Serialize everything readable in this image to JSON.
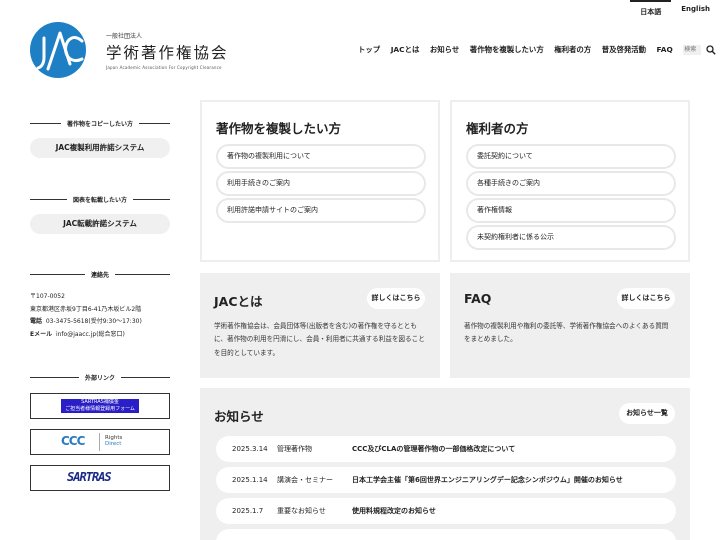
{
  "lang": {
    "ja": "日本語",
    "en": "English"
  },
  "logo": {
    "small": "一般社団法人",
    "main": "学術著作権協会",
    "en": "Japan Academic Association For Copyright Clearance",
    "color": "#1e7fc4"
  },
  "nav": {
    "items": [
      "トップ",
      "JACとは",
      "お知らせ",
      "著作物を複製したい方",
      "権利者の方",
      "普及啓発活動",
      "FAQ"
    ],
    "search_placeholder": "検索"
  },
  "sidebar": {
    "copy_heading": "著作物をコピーしたい方",
    "copy_button": "JAC複製利用許諾システム",
    "reprint_heading": "図表を転載したい方",
    "reprint_button": "JAC転載許諾システム",
    "contact_heading": "連絡先",
    "postal": "〒107-0052",
    "address": "東京都港区赤坂9丁目6-41乃木坂ビル2階",
    "tel_label": "電話",
    "tel": "03-3475-5618(受付9:30〜17:30)",
    "email_label": "Eメール",
    "email": "info@jaacc.jp(総合窓口)",
    "links_heading": "外部リンク",
    "sartras_line1": "SARTRAS補償金",
    "sartras_line2": "ご担当者様情報登録用フォーム",
    "ccc_label": "CCC",
    "rightsdirect_line1": "Rights",
    "rightsdirect_line2": "Direct",
    "sartras_logo": "SARTRAS"
  },
  "copy_card": {
    "title": "著作物を複製したい方",
    "items": [
      "著作物の複製利用について",
      "利用手続きのご案内",
      "利用許諾申請サイトのご案内"
    ]
  },
  "rights_card": {
    "title": "権利者の方",
    "items": [
      "委託契約について",
      "各種手続きのご案内",
      "著作権情報",
      "未契約権利者に係る公示"
    ]
  },
  "about": {
    "title": "JACとは",
    "more": "詳しくはこちら",
    "desc_lines": [
      "学術著作権協会は、会員団体等(出版者を含む)の著作権を守るととも",
      "に、著作物の利用を円滑にし、会員・利用者に共通する利益を図ること",
      "を目的としています。"
    ]
  },
  "faq": {
    "title": "FAQ",
    "more": "詳しくはこちら",
    "desc_lines": [
      "著作物の複製利用や権利の委託等、学術著作権協会へのよくある質問",
      "をまとめました。"
    ]
  },
  "news": {
    "title": "お知らせ",
    "more": "お知らせ一覧",
    "rows": [
      {
        "date": "2025.3.14",
        "cat": "管理著作物",
        "title": "CCC及びCLAの管理著作物の一部価格改定について"
      },
      {
        "date": "2025.1.14",
        "cat": "講演会・セミナー",
        "title": "日本工学会主催「第6回世界エンジニアリングデー記念シンポジウム」開催のお知らせ"
      },
      {
        "date": "2025.1.7",
        "cat": "重要なお知らせ",
        "title": "使用料規程改定のお知らせ"
      }
    ]
  }
}
